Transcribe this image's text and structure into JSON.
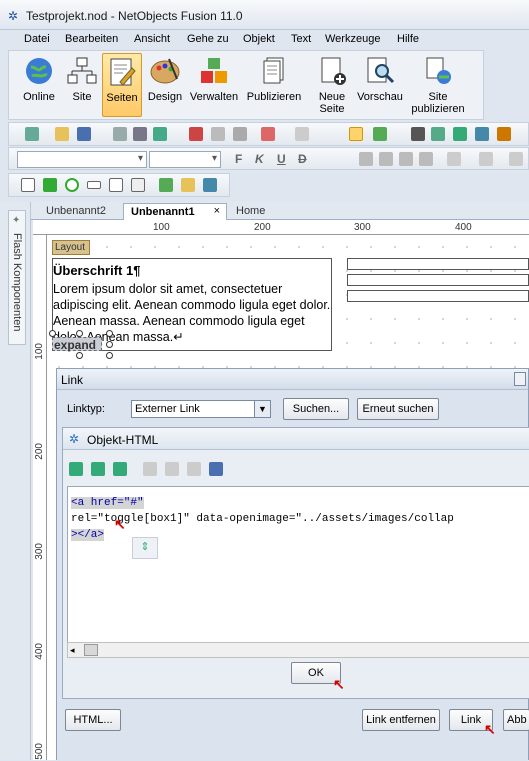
{
  "window": {
    "title": "Testprojekt.nod - NetObjects Fusion 11.0"
  },
  "menu": [
    "Datei",
    "Bearbeiten",
    "Ansicht",
    "Gehe zu",
    "Objekt",
    "Text",
    "Werkzeuge",
    "Hilfe"
  ],
  "ribbon": [
    {
      "label": "Online",
      "icon": "globe-icon"
    },
    {
      "label": "Site",
      "icon": "sitemap-icon"
    },
    {
      "label": "Seiten",
      "icon": "page-edit-icon",
      "active": true
    },
    {
      "label": "Design",
      "icon": "palette-icon"
    },
    {
      "label": "Verwalten",
      "icon": "cubes-icon"
    },
    {
      "label": "Publizieren",
      "icon": "publish-icon"
    },
    {
      "label": "Neue Seite",
      "icon": "new-page-icon"
    },
    {
      "label": "Vorschau",
      "icon": "preview-icon"
    },
    {
      "label": "Site publizieren",
      "icon": "publish-site-icon"
    }
  ],
  "format_toolbar": {
    "bold": "F",
    "italic": "K",
    "underline": "U",
    "strike": "D"
  },
  "sidebar": {
    "vertical_tab": "Flash Komponenten"
  },
  "tabs": [
    {
      "label": "Unbenannt2"
    },
    {
      "label": "Unbenannt1",
      "active": true,
      "close": "×"
    },
    {
      "label": "Home"
    }
  ],
  "ruler": {
    "h": [
      "100",
      "200",
      "300",
      "400"
    ],
    "v": [
      "100",
      "200",
      "300",
      "400",
      "500"
    ]
  },
  "page": {
    "layout_tag": "Layout",
    "heading": "Überschrift 1¶",
    "body": "Lorem ipsum dolor sit amet, consectetuer adipiscing elit. Aenean commodo ligula eget dolor. Aenean massa. Aenean commodo ligula eget dolor. Aenean massa.↵",
    "expand_link": "expand"
  },
  "link_dialog": {
    "title": "Link",
    "linktype_label": "Linktyp:",
    "linktype_value": "Externer Link",
    "search_button": "Suchen...",
    "search_again_button": "Erneut suchen",
    "html_button": "HTML...",
    "remove_link_button": "Link entfernen",
    "link_button": "Link",
    "cancel_button": "Abb"
  },
  "objekt_html": {
    "title": "Objekt-HTML",
    "code": {
      "line1": "<a href=\"#\"",
      "line2": "rel=\"toggle[box1]\" data-openimage=\"../assets/images/collap",
      "line3": "></a>"
    },
    "ok_button": "OK"
  },
  "colors": {
    "accent": "#ffc967",
    "annotation_arrow": "#d40000"
  }
}
